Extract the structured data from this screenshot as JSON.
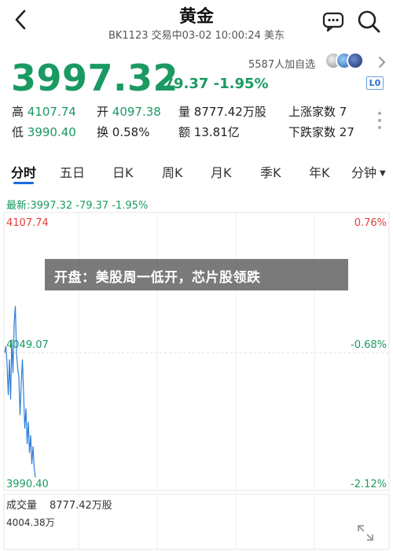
{
  "header": {
    "title": "黄金",
    "subtitle": "BK1123 交易中03-02 10:00:24 美东"
  },
  "quote": {
    "price": "3997.32",
    "change": "-79.37 -1.95%",
    "watchers": "5587人加自选",
    "badge": "L0"
  },
  "stats": {
    "high_label": "高",
    "high_value": "4107.74",
    "open_label": "开",
    "open_value": "4097.38",
    "volume_label": "量",
    "volume_value": "8777.42万股",
    "rise_label": "上涨家数",
    "rise_value": "7",
    "low_label": "低",
    "low_value": "3990.40",
    "turnover_label": "换",
    "turnover_value": "0.58%",
    "amount_label": "额",
    "amount_value": "13.81亿",
    "fall_label": "下跌家数",
    "fall_value": "27"
  },
  "tabs": [
    "分时",
    "五日",
    "日K",
    "周K",
    "月K",
    "季K",
    "年K",
    "分钟"
  ],
  "chart": {
    "info": "最新:3997.32  -79.37  -1.95%",
    "y_top": "4107.74",
    "y_mid": "4049.07",
    "y_bottom": "3990.40",
    "pct_top": "0.76%",
    "pct_mid": "-0.68%",
    "pct_bottom": "-2.12%",
    "banner": "开盘：美股周一低开，芯片股领跌"
  },
  "volume": {
    "label": "成交量",
    "value": "8777.42万股",
    "max": "4004.38万"
  },
  "colors": {
    "down_green": "#1a9a62",
    "up_red": "#e3413c",
    "accent_blue": "#1a6de0"
  },
  "chart_data": {
    "type": "line",
    "y_range": [
      3990.4,
      4107.74
    ],
    "series": [
      {
        "values": [
          4049.07,
          4052,
          4044,
          4030,
          4046,
          4028,
          4055,
          4040,
          4062,
          4070,
          4049,
          4042,
          4038,
          4021,
          4035,
          4046,
          4031,
          4015,
          4024,
          4008,
          4018,
          4004,
          4012,
          3999,
          4007,
          3997.32,
          3993
        ]
      }
    ]
  }
}
